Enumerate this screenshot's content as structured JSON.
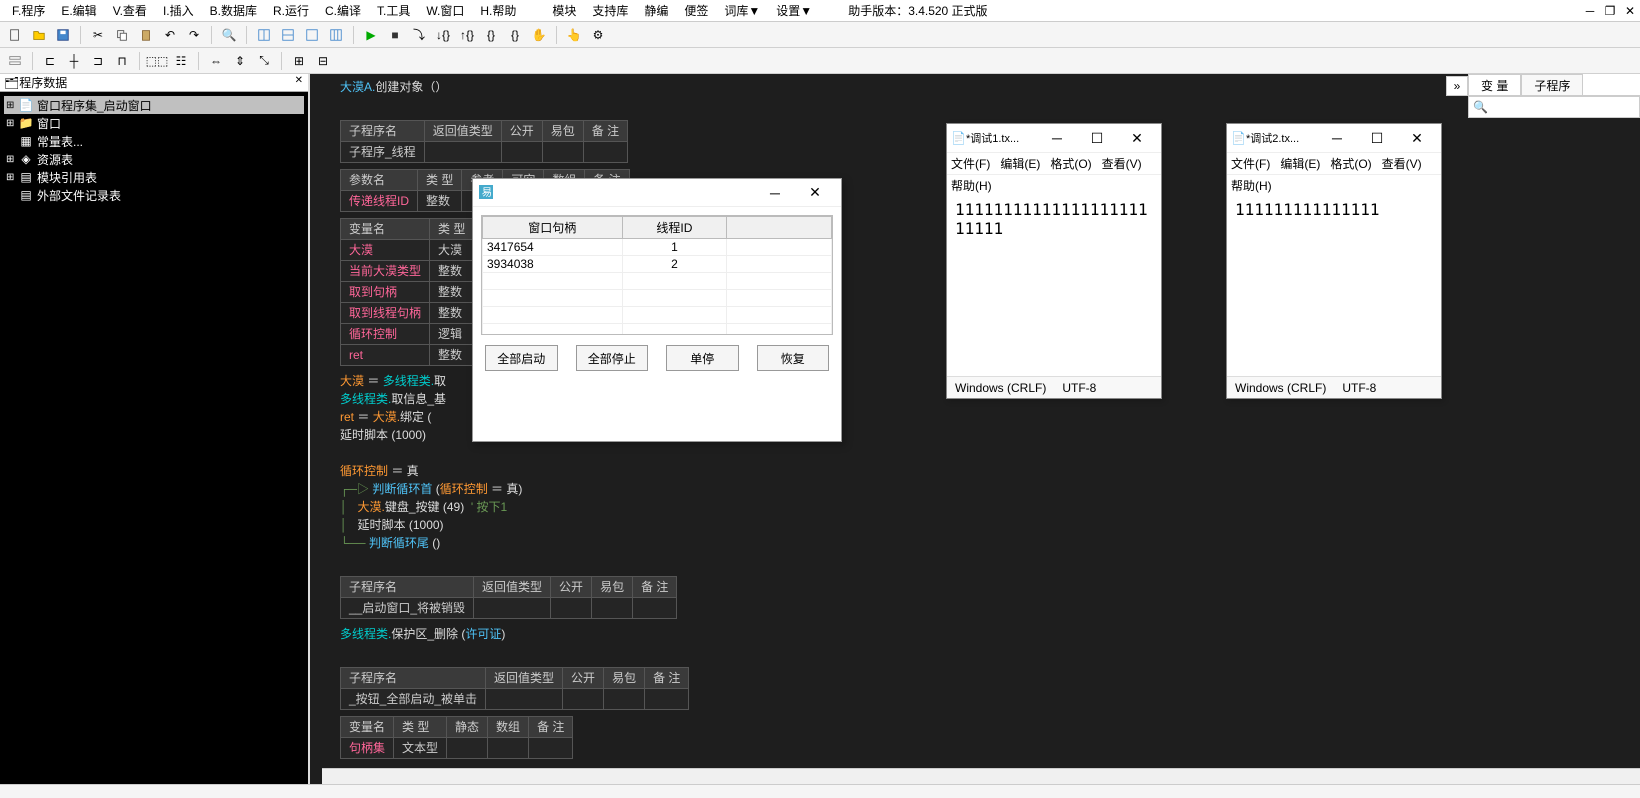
{
  "menubar": {
    "items": [
      "F.程序",
      "E.编辑",
      "V.查看",
      "I.插入",
      "B.数据库",
      "R.运行",
      "C.编译",
      "T.工具",
      "W.窗口",
      "H.帮助",
      "模块",
      "支持库",
      "静编",
      "便签",
      "词库▼",
      "设置▼"
    ],
    "version_label": "助手版本：3.4.520 正式版"
  },
  "left_panel": {
    "title": "程序数据",
    "tree": [
      {
        "label": "窗口程序集_启动窗口",
        "selected": true,
        "indent": 1
      },
      {
        "label": "窗口",
        "indent": 1
      },
      {
        "label": "常量表...",
        "indent": 1
      },
      {
        "label": "资源表",
        "indent": 1
      },
      {
        "label": "模块引用表",
        "indent": 1
      },
      {
        "label": "外部文件记录表",
        "indent": 1
      }
    ]
  },
  "editor": {
    "line1_a": "大漠A.",
    "line1_b": "创建对象",
    "line1_c": "（）",
    "table1": {
      "headers": [
        "子程序名",
        "返回值类型",
        "公开",
        "易包",
        "备 注"
      ],
      "row1": [
        "子程序_线程",
        "",
        "",
        "",
        ""
      ],
      "param_headers": [
        "参数名",
        "类 型",
        "参考",
        "可空",
        "数组",
        "备 注"
      ],
      "param_row": [
        "传递线程ID",
        "整数",
        "",
        "",
        "",
        ""
      ],
      "var_headers": [
        "变量名",
        "类 型"
      ],
      "var_rows": [
        [
          "大漠",
          "大漠"
        ],
        [
          "当前大漠类型",
          "整数"
        ],
        [
          "取到句柄",
          "整数"
        ],
        [
          "取到线程句柄",
          "整数"
        ],
        [
          "循环控制",
          "逻辑"
        ],
        [
          "ret",
          "整数"
        ]
      ]
    },
    "code_lines": [
      {
        "parts": [
          {
            "t": "大漠",
            "c": "orange"
          },
          {
            "t": " ＝ ",
            "c": "white"
          },
          {
            "t": "多线程类.",
            "c": "cyan"
          },
          {
            "t": "取",
            "c": "white"
          }
        ]
      },
      {
        "parts": [
          {
            "t": "多线程类.",
            "c": "cyan"
          },
          {
            "t": "取信息_基",
            "c": "white"
          }
        ]
      },
      {
        "parts": [
          {
            "t": "ret",
            "c": "orange"
          },
          {
            "t": " ＝ ",
            "c": "white"
          },
          {
            "t": "大漠.",
            "c": "orange"
          },
          {
            "t": "绑定",
            "c": "white"
          },
          {
            "t": " (",
            "c": "white"
          }
        ]
      },
      {
        "parts": [
          {
            "t": "延时脚本 (1000)",
            "c": "white"
          }
        ]
      },
      {
        "parts": []
      },
      {
        "parts": [
          {
            "t": "循环控制",
            "c": "orange"
          },
          {
            "t": " ＝ 真",
            "c": "white"
          }
        ]
      },
      {
        "parts": [
          {
            "t": "┌─▷ ",
            "c": "green"
          },
          {
            "t": "判断循环首",
            "c": "blue"
          },
          {
            "t": " (",
            "c": "white"
          },
          {
            "t": "循环控制",
            "c": "orange"
          },
          {
            "t": " ＝ 真)",
            "c": "white"
          }
        ]
      },
      {
        "parts": [
          {
            "t": "│   ",
            "c": "green"
          },
          {
            "t": "大漠.",
            "c": "orange"
          },
          {
            "t": "键盘_按键 (49)  ",
            "c": "white"
          },
          {
            "t": "' 按下1",
            "c": "green"
          }
        ]
      },
      {
        "parts": [
          {
            "t": "│   ",
            "c": "green"
          },
          {
            "t": "延时脚本 (1000)",
            "c": "white"
          }
        ]
      },
      {
        "parts": [
          {
            "t": "└── ",
            "c": "green"
          },
          {
            "t": "判断循环尾",
            "c": "blue"
          },
          {
            "t": " ()",
            "c": "white"
          }
        ]
      }
    ],
    "table2": {
      "headers": [
        "子程序名",
        "返回值类型",
        "公开",
        "易包",
        "备 注"
      ],
      "row": [
        "__启动窗口_将被销毁",
        "",
        "",
        "",
        ""
      ]
    },
    "line_destroy": [
      {
        "t": "多线程类.",
        "c": "cyan"
      },
      {
        "t": "保护区_删除 (",
        "c": "white"
      },
      {
        "t": "许可证",
        "c": "blue"
      },
      {
        "t": ")",
        "c": "white"
      }
    ],
    "table3": {
      "headers": [
        "子程序名",
        "返回值类型",
        "公开",
        "易包",
        "备 注"
      ],
      "row": [
        "_按钮_全部启动_被单击",
        "",
        "",
        "",
        ""
      ],
      "var_headers": [
        "变量名",
        "类 型",
        "静态",
        "数组",
        "备 注"
      ],
      "var_row": [
        "句柄集",
        "文本型",
        "",
        "",
        ""
      ]
    }
  },
  "right_panel": {
    "collapse_icon": "»",
    "tabs": [
      "变 量",
      "子程序"
    ],
    "search_placeholder": ""
  },
  "dialog": {
    "title": "",
    "table_headers": [
      "窗口句柄",
      "线程ID"
    ],
    "rows": [
      {
        "handle": "3417654",
        "thread": "1"
      },
      {
        "handle": "3934038",
        "thread": "2"
      }
    ],
    "buttons": [
      "全部启动",
      "全部停止",
      "单停",
      "恢复"
    ]
  },
  "notepad1": {
    "title": "*调试1.tx...",
    "menu": [
      "文件(F)",
      "编辑(E)",
      "格式(O)",
      "查看(V)",
      "帮助(H)"
    ],
    "content": "1111111111111111111111111",
    "status": [
      "Windows (CRLF)",
      "UTF-8"
    ]
  },
  "notepad2": {
    "title": "*调试2.tx...",
    "menu": [
      "文件(F)",
      "编辑(E)",
      "格式(O)",
      "查看(V)",
      "帮助(H)"
    ],
    "content": "111111111111111",
    "status": [
      "Windows (CRLF)",
      "UTF-8"
    ]
  }
}
